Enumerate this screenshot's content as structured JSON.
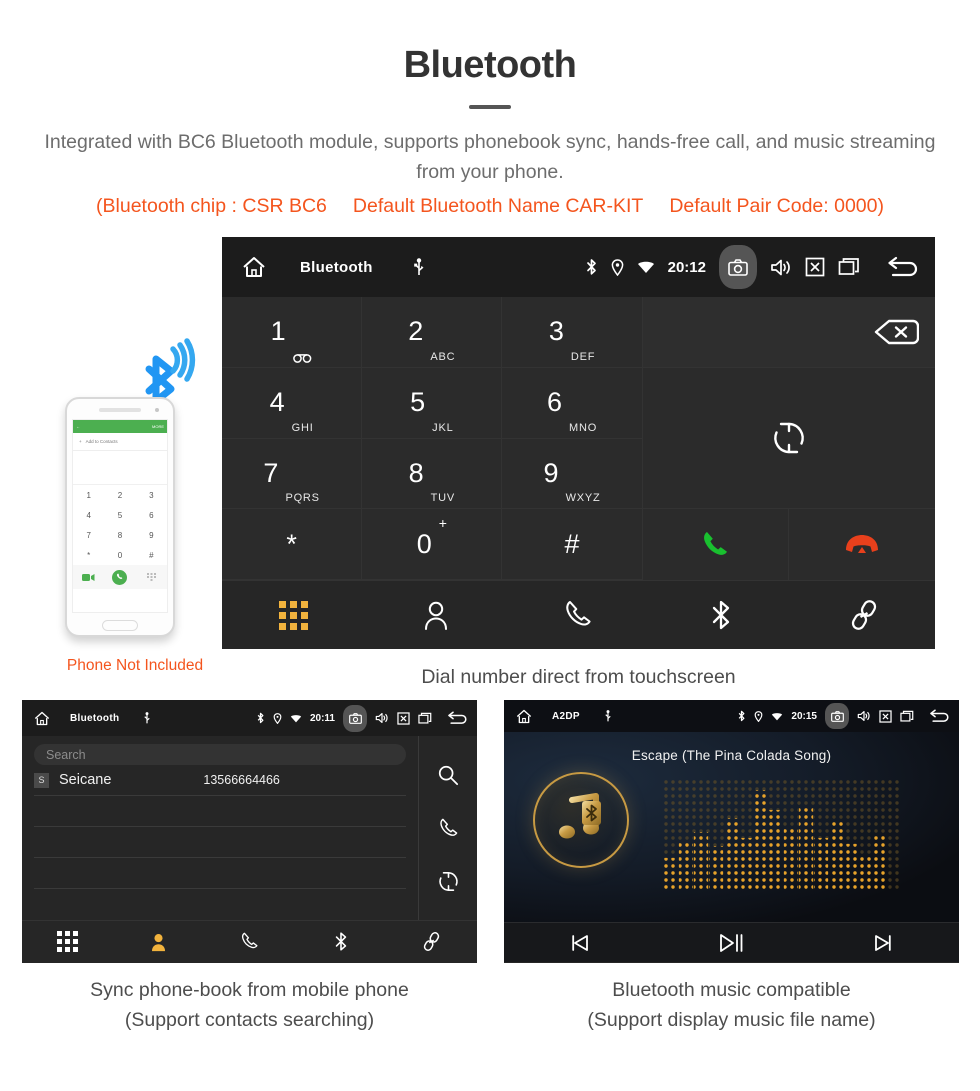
{
  "header": {
    "title": "Bluetooth",
    "subtitle": "Integrated with BC6 Bluetooth module, supports phonebook sync, hands-free call, and music streaming from your phone.",
    "spec_chip": "(Bluetooth chip : CSR BC6",
    "spec_name": "Default Bluetooth Name CAR-KIT",
    "spec_pair": "Default Pair Code: 0000)",
    "accent_color": "#f4551e",
    "text_color": "#6d6d6d"
  },
  "dialer": {
    "statusbar": {
      "title": "Bluetooth",
      "time": "20:12",
      "icons": [
        "home-icon",
        "usb-icon",
        "bluetooth-icon",
        "location-icon",
        "wifi-icon",
        "camera-icon",
        "volume-icon",
        "close-box-icon",
        "recents-icon",
        "back-icon"
      ]
    },
    "keys": [
      {
        "num": "1",
        "sub": "",
        "voicemail": true
      },
      {
        "num": "2",
        "sub": "ABC"
      },
      {
        "num": "3",
        "sub": "DEF"
      },
      {
        "num": "4",
        "sub": "GHI"
      },
      {
        "num": "5",
        "sub": "JKL"
      },
      {
        "num": "6",
        "sub": "MNO"
      },
      {
        "num": "7",
        "sub": "PQRS"
      },
      {
        "num": "8",
        "sub": "TUV"
      },
      {
        "num": "9",
        "sub": "WXYZ"
      },
      {
        "num": "*",
        "sub": ""
      },
      {
        "num": "0",
        "sup": "+"
      },
      {
        "num": "#",
        "sub": ""
      }
    ],
    "number_display": "",
    "navbar": [
      "dialpad-icon",
      "contacts-icon",
      "call-log-icon",
      "bluetooth-icon",
      "link-icon"
    ],
    "active_nav": "dialpad-icon",
    "active_color": "#f2b33d",
    "call_color": "#19c02f",
    "hangup_color": "#e8401c",
    "caption": "Dial number direct from touchscreen"
  },
  "phone_illustration": {
    "screen_header_more": "MORE",
    "add_to_contacts": "Add to Contacts",
    "keys": [
      "1",
      "2",
      "3",
      "4",
      "5",
      "6",
      "7",
      "8",
      "9",
      "*",
      "0",
      "#"
    ],
    "caption": "Phone Not Included",
    "bluetooth_color": "#2196f3"
  },
  "phonebook": {
    "statusbar": {
      "title": "Bluetooth",
      "time": "20:11"
    },
    "search_placeholder": "Search",
    "contacts": [
      {
        "initial": "S",
        "name": "Seicane",
        "phone": "13566664466"
      }
    ],
    "rail_icons": [
      "search-icon",
      "call-icon",
      "sync-icon"
    ],
    "navbar": [
      "dialpad-icon",
      "contacts-icon",
      "call-log-icon",
      "bluetooth-icon",
      "link-icon"
    ],
    "active_nav": "contacts-icon",
    "caption_line1": "Sync phone-book from mobile phone",
    "caption_line2": "(Support contacts searching)"
  },
  "music": {
    "statusbar": {
      "title": "A2DP",
      "time": "20:15"
    },
    "song_title": "Escape (The Pina Colada Song)",
    "controls": [
      "previous-icon",
      "play-pause-icon",
      "next-icon"
    ],
    "accent_color": "#c79a43",
    "caption_line1": "Bluetooth music compatible",
    "caption_line2": "(Support display music file name)"
  }
}
